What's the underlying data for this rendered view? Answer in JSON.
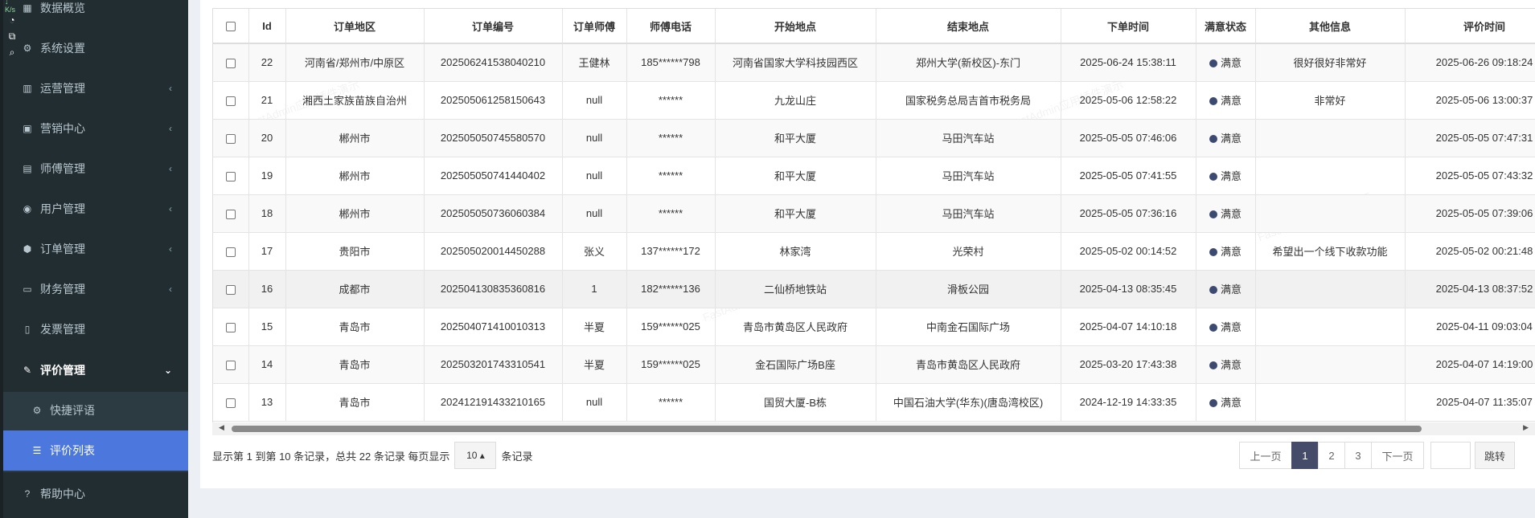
{
  "sidebar": {
    "items": [
      {
        "label": "数据概览",
        "icon": "dashboard-icon"
      },
      {
        "label": "系统设置",
        "icon": "gear-icon"
      },
      {
        "label": "运营管理",
        "icon": "chart-icon",
        "arrow": "‹"
      },
      {
        "label": "营销中心",
        "icon": "calendar-icon",
        "arrow": "‹"
      },
      {
        "label": "师傅管理",
        "icon": "id-card-icon",
        "arrow": "‹"
      },
      {
        "label": "用户管理",
        "icon": "user-icon",
        "arrow": "‹"
      },
      {
        "label": "订单管理",
        "icon": "cube-icon",
        "arrow": "‹"
      },
      {
        "label": "财务管理",
        "icon": "money-icon",
        "arrow": "‹"
      },
      {
        "label": "发票管理",
        "icon": "file-icon"
      },
      {
        "label": "评价管理",
        "icon": "edit-icon",
        "arrow": "⌄"
      },
      {
        "label": "快捷评语",
        "icon": "gear-icon"
      },
      {
        "label": "评价列表",
        "icon": "list-icon"
      },
      {
        "label": "帮助中心",
        "icon": "help-icon"
      }
    ]
  },
  "float_tools": {
    "top_label": "↓ K/s"
  },
  "table": {
    "columns": [
      "",
      "Id",
      "订单地区",
      "订单编号",
      "订单师傅",
      "师傅电话",
      "开始地点",
      "结束地点",
      "下单时间",
      "满意状态",
      "其他信息",
      "评价时间"
    ],
    "rows": [
      {
        "id": "22",
        "region": "河南省/郑州市/中原区",
        "order_no": "202506241538040210",
        "master": "王健林",
        "phone": "185******798",
        "start": "河南省国家大学科技园西区",
        "end": "郑州大学(新校区)-东门",
        "order_time": "2025-06-24 15:38:11",
        "status": "满意",
        "info": "很好很好非常好",
        "review_time": "2025-06-26 09:18:24"
      },
      {
        "id": "21",
        "region": "湘西土家族苗族自治州",
        "order_no": "202505061258150643",
        "master": "null",
        "phone": "******",
        "start": "九龙山庄",
        "end": "国家税务总局吉首市税务局",
        "order_time": "2025-05-06 12:58:22",
        "status": "满意",
        "info": "非常好",
        "review_time": "2025-05-06 13:00:37"
      },
      {
        "id": "20",
        "region": "郴州市",
        "order_no": "202505050745580570",
        "master": "null",
        "phone": "******",
        "start": "和平大厦",
        "end": "马田汽车站",
        "order_time": "2025-05-05 07:46:06",
        "status": "满意",
        "info": "",
        "review_time": "2025-05-05 07:47:31"
      },
      {
        "id": "19",
        "region": "郴州市",
        "order_no": "202505050741440402",
        "master": "null",
        "phone": "******",
        "start": "和平大厦",
        "end": "马田汽车站",
        "order_time": "2025-05-05 07:41:55",
        "status": "满意",
        "info": "",
        "review_time": "2025-05-05 07:43:32"
      },
      {
        "id": "18",
        "region": "郴州市",
        "order_no": "202505050736060384",
        "master": "null",
        "phone": "******",
        "start": "和平大厦",
        "end": "马田汽车站",
        "order_time": "2025-05-05 07:36:16",
        "status": "满意",
        "info": "",
        "review_time": "2025-05-05 07:39:06"
      },
      {
        "id": "17",
        "region": "贵阳市",
        "order_no": "202505020014450288",
        "master": "张义",
        "phone": "137******172",
        "start": "林家湾",
        "end": "光荣村",
        "order_time": "2025-05-02 00:14:52",
        "status": "满意",
        "info": "希望出一个线下收款功能",
        "review_time": "2025-05-02 00:21:48"
      },
      {
        "id": "16",
        "region": "成都市",
        "order_no": "202504130835360816",
        "master": "1",
        "phone": "182******136",
        "start": "二仙桥地铁站",
        "end": "滑板公园",
        "order_time": "2025-04-13 08:35:45",
        "status": "满意",
        "info": "",
        "review_time": "2025-04-13 08:37:52"
      },
      {
        "id": "15",
        "region": "青岛市",
        "order_no": "202504071410010313",
        "master": "半夏",
        "phone": "159******025",
        "start": "青岛市黄岛区人民政府",
        "end": "中南金石国际广场",
        "order_time": "2025-04-07 14:10:18",
        "status": "满意",
        "info": "",
        "review_time": "2025-04-11 09:03:04"
      },
      {
        "id": "14",
        "region": "青岛市",
        "order_no": "202503201743310541",
        "master": "半夏",
        "phone": "159******025",
        "start": "金石国际广场B座",
        "end": "青岛市黄岛区人民政府",
        "order_time": "2025-03-20 17:43:38",
        "status": "满意",
        "info": "",
        "review_time": "2025-04-07 14:19:00"
      },
      {
        "id": "13",
        "region": "青岛市",
        "order_no": "202412191433210165",
        "master": "null",
        "phone": "******",
        "start": "国贸大厦-B栋",
        "end": "中国石油大学(华东)(唐岛湾校区)",
        "order_time": "2024-12-19 14:33:35",
        "status": "满意",
        "info": "",
        "review_time": "2025-04-07 11:35:07"
      }
    ]
  },
  "footer": {
    "info_prefix": "显示第 1 到第 10 条记录，总共 22 条记录 每页显示",
    "page_size": "10 ▴",
    "info_suffix": "条记录",
    "prev": "上一页",
    "pages": [
      "1",
      "2",
      "3"
    ],
    "next": "下一页",
    "jump": "跳转"
  },
  "watermark": "FastAdmin应用插件演示",
  "colors": {
    "accent": "#4c78dd",
    "sidebar": "#222d32",
    "pager_active": "#444c69",
    "status_dot": "#3c4a72"
  }
}
